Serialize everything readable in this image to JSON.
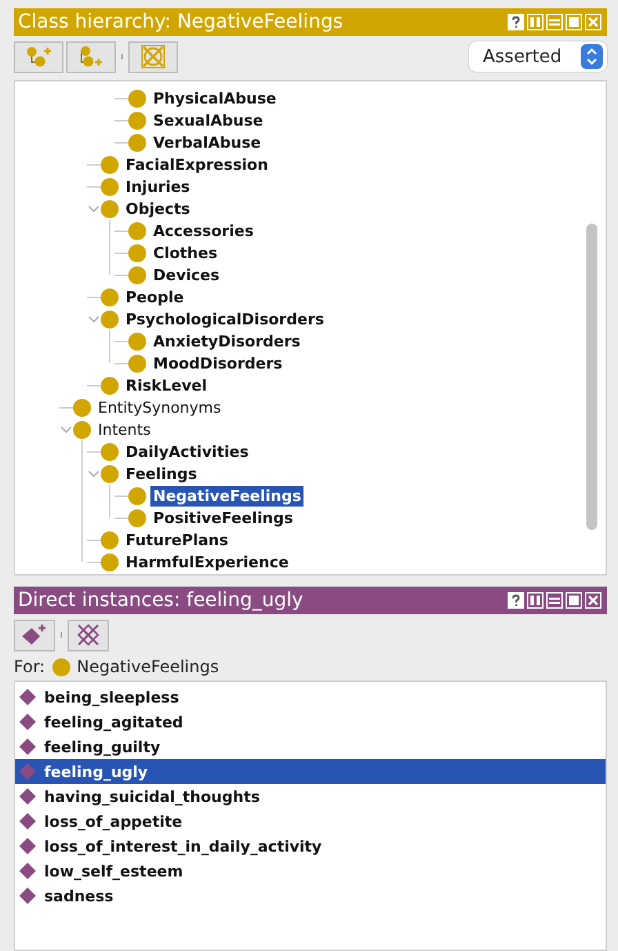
{
  "class_panel": {
    "title": "Class hierarchy: NegativeFeelings",
    "view_mode": "Asserted",
    "tree": [
      {
        "children": [
          {
            "children": [
              {
                "label": "PhysicalAbuse",
                "bold": true,
                "selected": false
              },
              {
                "label": "SexualAbuse",
                "bold": true,
                "selected": false
              },
              {
                "label": "VerbalAbuse",
                "bold": true,
                "selected": false
              }
            ]
          },
          {
            "label": "FacialExpression",
            "bold": true,
            "selected": false
          },
          {
            "label": "Injuries",
            "bold": true,
            "selected": false
          },
          {
            "label": "Objects",
            "bold": true,
            "selected": false,
            "expanded": true,
            "children": [
              {
                "label": "Accessories",
                "bold": true,
                "selected": false
              },
              {
                "label": "Clothes",
                "bold": true,
                "selected": false
              },
              {
                "label": "Devices",
                "bold": true,
                "selected": false
              }
            ]
          },
          {
            "label": "People",
            "bold": true,
            "selected": false
          },
          {
            "label": "PsychologicalDisorders",
            "bold": true,
            "selected": false,
            "expanded": true,
            "children": [
              {
                "label": "AnxietyDisorders",
                "bold": true,
                "selected": false
              },
              {
                "label": "MoodDisorders",
                "bold": true,
                "selected": false
              }
            ]
          },
          {
            "label": "RiskLevel",
            "bold": true,
            "selected": false
          }
        ]
      },
      {
        "label": "EntitySynonyms",
        "bold": false,
        "selected": false
      },
      {
        "label": "Intents",
        "bold": false,
        "selected": false,
        "expanded": true,
        "children": [
          {
            "label": "DailyActivities",
            "bold": true,
            "selected": false
          },
          {
            "label": "Feelings",
            "bold": true,
            "selected": false,
            "expanded": true,
            "children": [
              {
                "label": "NegativeFeelings",
                "bold": true,
                "selected": true
              },
              {
                "label": "PositiveFeelings",
                "bold": true,
                "selected": false
              }
            ]
          },
          {
            "label": "FuturePlans",
            "bold": true,
            "selected": false
          },
          {
            "label": "HarmfulExperience",
            "bold": true,
            "selected": false
          }
        ]
      }
    ]
  },
  "instances_panel": {
    "title": "Direct instances: feeling_ugly",
    "for_label": "For:",
    "for_class": "NegativeFeelings",
    "items": [
      {
        "label": "being_sleepless",
        "selected": false
      },
      {
        "label": "feeling_agitated",
        "selected": false
      },
      {
        "label": "feeling_guilty",
        "selected": false
      },
      {
        "label": "feeling_ugly",
        "selected": true
      },
      {
        "label": "having_suicidal_thoughts",
        "selected": false
      },
      {
        "label": "loss_of_appetite",
        "selected": false
      },
      {
        "label": "loss_of_interest_in_daily_activity",
        "selected": false
      },
      {
        "label": "low_self_esteem",
        "selected": false
      },
      {
        "label": "sadness",
        "selected": false
      }
    ]
  }
}
